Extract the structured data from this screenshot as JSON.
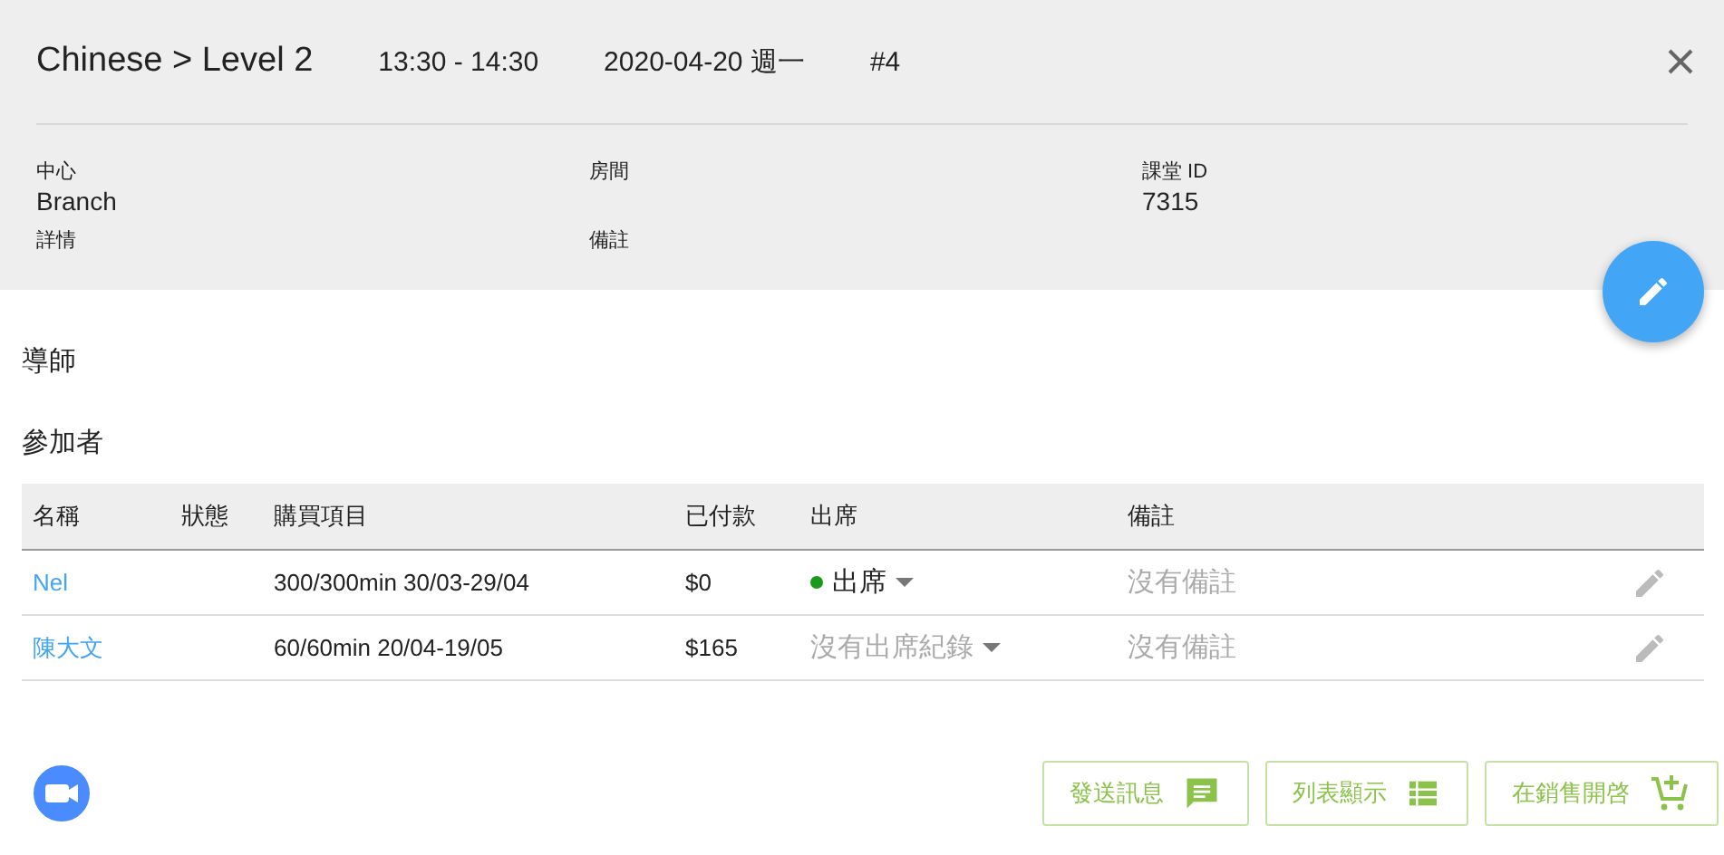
{
  "header": {
    "title": "Chinese > Level 2",
    "time": "13:30 - 14:30",
    "date": "2020-04-20 週一",
    "number": "#4"
  },
  "info": [
    {
      "label": "中心",
      "value": "Branch"
    },
    {
      "label": "房間"
    },
    {
      "label": "課堂 ID",
      "value": "7315"
    },
    {
      "label": "詳情"
    },
    {
      "label": "備註"
    }
  ],
  "sections": {
    "teacher": "導師",
    "participants": "參加者"
  },
  "table": {
    "columns": [
      "名稱",
      "狀態",
      "購買項目",
      "已付款",
      "出席",
      "備註"
    ],
    "rows": [
      {
        "name": "Nel",
        "item": "300/300min 30/03-29/04",
        "paid": "$0",
        "attendance": "出席",
        "attendance_recorded": true,
        "note": "沒有備註"
      },
      {
        "name": "陳大文",
        "item": "60/60min 20/04-19/05",
        "paid": "$165",
        "attendance": "沒有出席紀錄",
        "attendance_recorded": false,
        "note": "沒有備註"
      }
    ]
  },
  "buttons": [
    {
      "label": "發送訊息",
      "kind": "message"
    },
    {
      "label": "列表顯示",
      "kind": "list"
    },
    {
      "label": "在銷售開啓",
      "kind": "cart"
    }
  ]
}
